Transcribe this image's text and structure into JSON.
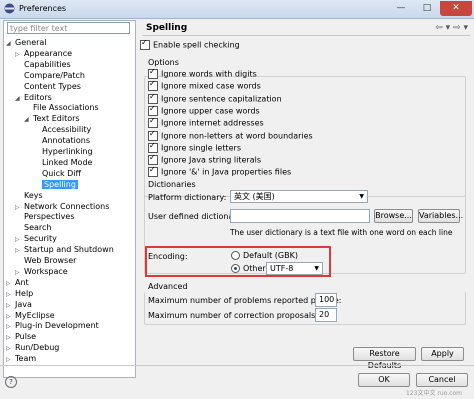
{
  "window": {
    "title": "Preferences",
    "minimize": "—",
    "maximize": "□",
    "close": "✕"
  },
  "filter": {
    "placeholder": "type filter text"
  },
  "tree": [
    {
      "label": "General",
      "level": 0,
      "expanded": true
    },
    {
      "label": "Appearance",
      "level": 1,
      "expanded": false,
      "has_children": true
    },
    {
      "label": "Capabilities",
      "level": 1
    },
    {
      "label": "Compare/Patch",
      "level": 1
    },
    {
      "label": "Content Types",
      "level": 1
    },
    {
      "label": "Editors",
      "level": 1,
      "expanded": true
    },
    {
      "label": "File Associations",
      "level": 2
    },
    {
      "label": "Text Editors",
      "level": 2,
      "expanded": true
    },
    {
      "label": "Accessibility",
      "level": 3
    },
    {
      "label": "Annotations",
      "level": 3
    },
    {
      "label": "Hyperlinking",
      "level": 3
    },
    {
      "label": "Linked Mode",
      "level": 3
    },
    {
      "label": "Quick Diff",
      "level": 3
    },
    {
      "label": "Spelling",
      "level": 3,
      "selected": true
    },
    {
      "label": "Keys",
      "level": 1
    },
    {
      "label": "Network Connections",
      "level": 1,
      "has_children": true
    },
    {
      "label": "Perspectives",
      "level": 1
    },
    {
      "label": "Search",
      "level": 1
    },
    {
      "label": "Security",
      "level": 1,
      "has_children": true
    },
    {
      "label": "Startup and Shutdown",
      "level": 1,
      "has_children": true
    },
    {
      "label": "Web Browser",
      "level": 1
    },
    {
      "label": "Workspace",
      "level": 1,
      "has_children": true
    },
    {
      "label": "Ant",
      "level": 0,
      "has_children": true
    },
    {
      "label": "Help",
      "level": 0,
      "has_children": true
    },
    {
      "label": "Java",
      "level": 0,
      "has_children": true
    },
    {
      "label": "MyEclipse",
      "level": 0,
      "has_children": true
    },
    {
      "label": "Plug-in Development",
      "level": 0,
      "has_children": true
    },
    {
      "label": "Pulse",
      "level": 0,
      "has_children": true
    },
    {
      "label": "Run/Debug",
      "level": 0,
      "has_children": true
    },
    {
      "label": "Team",
      "level": 0,
      "has_children": true
    }
  ],
  "page": {
    "title": "Spelling",
    "nav_back": "⇦",
    "nav_forward": "⇨",
    "nav_menu": "▾",
    "enable_spell": {
      "label": "Enable spell checking",
      "checked": true
    },
    "options_label": "Options",
    "options": [
      {
        "label": "Ignore words with digits",
        "checked": true
      },
      {
        "label": "Ignore mixed case words",
        "checked": true
      },
      {
        "label": "Ignore sentence capitalization",
        "checked": true
      },
      {
        "label": "Ignore upper case words",
        "checked": true
      },
      {
        "label": "Ignore internet addresses",
        "checked": true
      },
      {
        "label": "Ignore non-letters at word boundaries",
        "checked": true
      },
      {
        "label": "Ignore single letters",
        "checked": true
      },
      {
        "label": "Ignore Java string literals",
        "checked": true
      },
      {
        "label": "Ignore '&' in Java properties files",
        "checked": true
      }
    ],
    "dictionaries_label": "Dictionaries",
    "platform_dict_label": "Platform dictionary:",
    "platform_dict_value": "英文 (美国)",
    "user_dict_label": "User defined dictionary:",
    "user_dict_value": "",
    "browse_button": "Browse...",
    "variables_button": "Variables...",
    "user_dict_note": "The user dictionary is a text file with one word on each line",
    "encoding_label": "Encoding:",
    "encoding_default": "Default (GBK)",
    "encoding_other_label": "Other:",
    "encoding_other_value": "UTF-8",
    "encoding_selected": "other",
    "advanced_label": "Advanced",
    "max_problems_label": "Maximum number of problems reported per file:",
    "max_problems_value": "100",
    "max_corrections_label": "Maximum number of correction proposals:",
    "max_corrections_value": "20",
    "restore_button": "Restore Defaults",
    "apply_button": "Apply"
  },
  "footer": {
    "help_icon": "?",
    "ok_button": "OK",
    "cancel_button": "Cancel"
  },
  "watermark": "123文中文 ruo.com",
  "colors": {
    "selection": "#3399ff",
    "highlight_border": "#e03838",
    "close_button": "#c7463d"
  }
}
